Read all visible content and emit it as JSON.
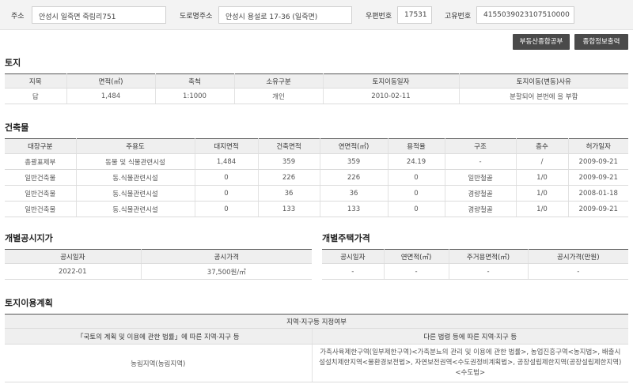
{
  "address_bar": {
    "addr_label": "주소",
    "addr_value": "안성시 일죽면 죽림리751",
    "road_label": "도로명주소",
    "road_value": "안성시 용설로 17-36 (일죽면)",
    "zip_label": "우편번호",
    "zip_value": "17531",
    "id_label": "고유번호",
    "id_value": "4155039023107510000"
  },
  "buttons": {
    "realestate": "부동산종합공부",
    "summary_print": "종합정보출력"
  },
  "land": {
    "title": "토지",
    "headers": [
      "지목",
      "면적(㎡)",
      "축척",
      "소유구분",
      "토지이동일자",
      "토지이동(변동)사유"
    ],
    "rows": [
      [
        "답",
        "1,484",
        "1:1000",
        "개인",
        "2010-02-11",
        "분할되어 본번에 을 부함"
      ]
    ]
  },
  "building": {
    "title": "건축물",
    "headers": [
      "대장구분",
      "주용도",
      "대지면적",
      "건축면적",
      "연면적(㎡)",
      "용적율",
      "구조",
      "층수",
      "허가일자"
    ],
    "rows": [
      [
        "총괄표제부",
        "동물 및 식물관련시설",
        "1,484",
        "359",
        "359",
        "24.19",
        "-",
        "/",
        "2009-09-21"
      ],
      [
        "일반건축물",
        "동.식물관련시설",
        "0",
        "226",
        "226",
        "0",
        "일반철골",
        "1/0",
        "2009-09-21"
      ],
      [
        "일반건축물",
        "동.식물관련시설",
        "0",
        "36",
        "36",
        "0",
        "경량철골",
        "1/0",
        "2008-01-18"
      ],
      [
        "일반건축물",
        "동.식물관련시설",
        "0",
        "133",
        "133",
        "0",
        "경량철골",
        "1/0",
        "2009-09-21"
      ]
    ]
  },
  "land_price": {
    "title": "개별공시지가",
    "headers": [
      "공시일자",
      "공시가격"
    ],
    "rows": [
      [
        "2022-01",
        "37,500원/㎡"
      ]
    ]
  },
  "house_price": {
    "title": "개별주택가격",
    "headers": [
      "공시일자",
      "연면적(㎡)",
      "주거용면적(㎡)",
      "공시가격(만원)"
    ],
    "rows": [
      [
        "-",
        "-",
        "-",
        "-"
      ]
    ]
  },
  "land_use": {
    "title": "토지이용계획",
    "top_header": "지역·지구등 지정여부",
    "headers": [
      "「국토의 계획 및 이용에 관한 법률」에 따른 지역·지구 등",
      "다른 법령 등에 따른 지역·지구 등"
    ],
    "row": [
      "농림지역(농림지역)",
      "가축사육제한구역(일부제한구역)<가축분뇨의 관리 및 이용에 관한 법률>, 농업진흥구역<농지법>, 배출시설설치제한지역<물환경보전법>, 자연보전권역<수도권정비계획법>, 공장설립제한지역(공장설립제한지역)<수도법>"
    ]
  }
}
